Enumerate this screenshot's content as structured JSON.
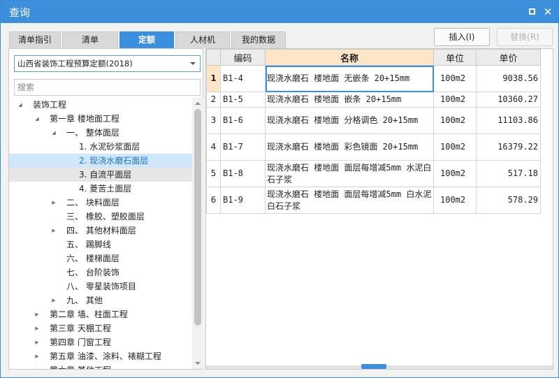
{
  "window": {
    "title": "查询",
    "maximize_icon": "maximize-icon",
    "close_icon": "close-icon",
    "close_glyph": "✕"
  },
  "tabs": [
    {
      "label": "清单指引",
      "active": false
    },
    {
      "label": "清单",
      "active": false
    },
    {
      "label": "定额",
      "active": true
    },
    {
      "label": "人材机",
      "active": false
    },
    {
      "label": "我的数据",
      "active": false
    }
  ],
  "actions": {
    "insert_label": "插入(I)",
    "replace_label": "替换(R)"
  },
  "library_select": {
    "value": "山西省装饰工程预算定额(2018)"
  },
  "search": {
    "placeholder": "搜索",
    "value": ""
  },
  "tree": [
    {
      "label": "装饰工程",
      "level": 0,
      "toggle": "open"
    },
    {
      "label": "第一章 楼地面工程",
      "level": 1,
      "toggle": "open"
    },
    {
      "label": "一、 整体面层",
      "level": 2,
      "toggle": "open"
    },
    {
      "label": "1. 水泥砂浆面层",
      "level": 3,
      "toggle": "none"
    },
    {
      "label": "2. 现浇水磨石面层",
      "level": 3,
      "toggle": "none",
      "state": "selected"
    },
    {
      "label": "3. 自流平面层",
      "level": 3,
      "toggle": "none",
      "state": "hover"
    },
    {
      "label": "4. 菱苦土面层",
      "level": 3,
      "toggle": "none"
    },
    {
      "label": "二、 块料面层",
      "level": 2,
      "toggle": "closed"
    },
    {
      "label": "三、 橡胶、塑胶面层",
      "level": 2,
      "toggle": "none"
    },
    {
      "label": "四、 其他材料面层",
      "level": 2,
      "toggle": "closed"
    },
    {
      "label": "五、 踢脚线",
      "level": 2,
      "toggle": "none"
    },
    {
      "label": "六、 楼梯面层",
      "level": 2,
      "toggle": "none"
    },
    {
      "label": "七、 台阶装饰",
      "level": 2,
      "toggle": "none"
    },
    {
      "label": "八、 零星装饰项目",
      "level": 2,
      "toggle": "none"
    },
    {
      "label": "九、 其他",
      "level": 2,
      "toggle": "closed"
    },
    {
      "label": "第二章 墙、柱面工程",
      "level": 1,
      "toggle": "closed"
    },
    {
      "label": "第三章 天棚工程",
      "level": 1,
      "toggle": "closed"
    },
    {
      "label": "第四章 门窗工程",
      "level": 1,
      "toggle": "closed"
    },
    {
      "label": "第五章 油漆、涂料、裱糊工程",
      "level": 1,
      "toggle": "closed"
    },
    {
      "label": "第六章 其他工程",
      "level": 1,
      "toggle": "closed"
    }
  ],
  "table": {
    "columns": [
      "",
      "编码",
      "名称",
      "单位",
      "单价"
    ],
    "rows": [
      {
        "no": "1",
        "code": "B1-4",
        "name": "现浇水磨石 楼地面 无嵌条 20+15mm",
        "unit": "100m2",
        "price": "9038.56",
        "active": true
      },
      {
        "no": "2",
        "code": "B1-5",
        "name": "现浇水磨石 楼地面 嵌条 20+15mm",
        "unit": "100m2",
        "price": "10360.27"
      },
      {
        "no": "3",
        "code": "B1-6",
        "name": "现浇水磨石 楼地面 分格调色 20+15mm",
        "unit": "100m2",
        "price": "11103.86"
      },
      {
        "no": "4",
        "code": "B1-7",
        "name": "现浇水磨石 楼地面 彩色镜面 20+15mm",
        "unit": "100m2",
        "price": "16379.22"
      },
      {
        "no": "5",
        "code": "B1-8",
        "name": "现浇水磨石 楼地面 面层每增减5mm 水泥白石子浆",
        "unit": "100m2",
        "price": "517.18"
      },
      {
        "no": "6",
        "code": "B1-9",
        "name": "现浇水磨石 楼地面 面层每增减5mm 白水泥白石子浆",
        "unit": "100m2",
        "price": "578.29"
      }
    ]
  },
  "colors": {
    "accent": "#3d8fdb",
    "active_header": "#fde5c8",
    "selected_node": "#cfe6fb"
  }
}
